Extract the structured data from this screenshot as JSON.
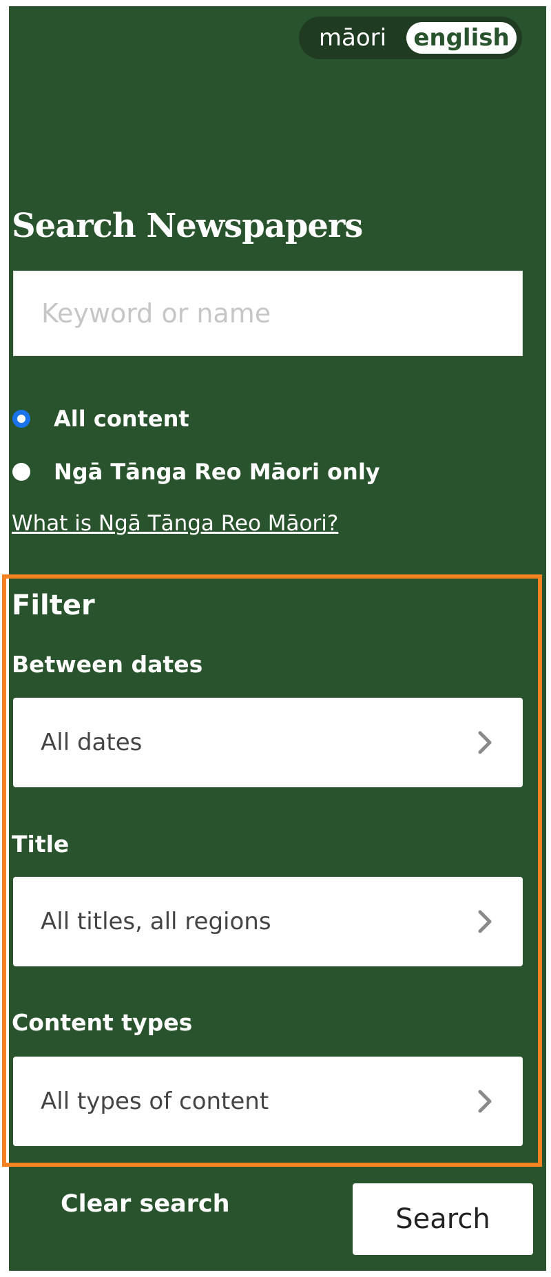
{
  "language_toggle": {
    "maori_label": "māori",
    "english_label": "english",
    "active": "english"
  },
  "search": {
    "title": "Search Newspapers",
    "input_value": "",
    "placeholder": "Keyword or name"
  },
  "content_options": [
    {
      "label": "All content",
      "checked": true
    },
    {
      "label": "Ngā Tānga Reo Māori only",
      "checked": false
    }
  ],
  "info_link": "What is Ngā Tānga Reo Māori?",
  "filter": {
    "heading": "Filter",
    "dates": {
      "label": "Between dates",
      "value": "All dates"
    },
    "title": {
      "label": "Title",
      "value": "All titles, all regions"
    },
    "content_types": {
      "label": "Content types",
      "value": "All types of content"
    }
  },
  "actions": {
    "clear_label": "Clear search",
    "search_label": "Search"
  },
  "colors": {
    "panel_background": "#28532c",
    "toggle_background": "#1f3b22",
    "highlight_border": "#f58220",
    "radio_checked": "#1a73e8",
    "chevron": "#8a8a8a"
  },
  "icons": {
    "select_arrow": "chevron-right-icon"
  }
}
